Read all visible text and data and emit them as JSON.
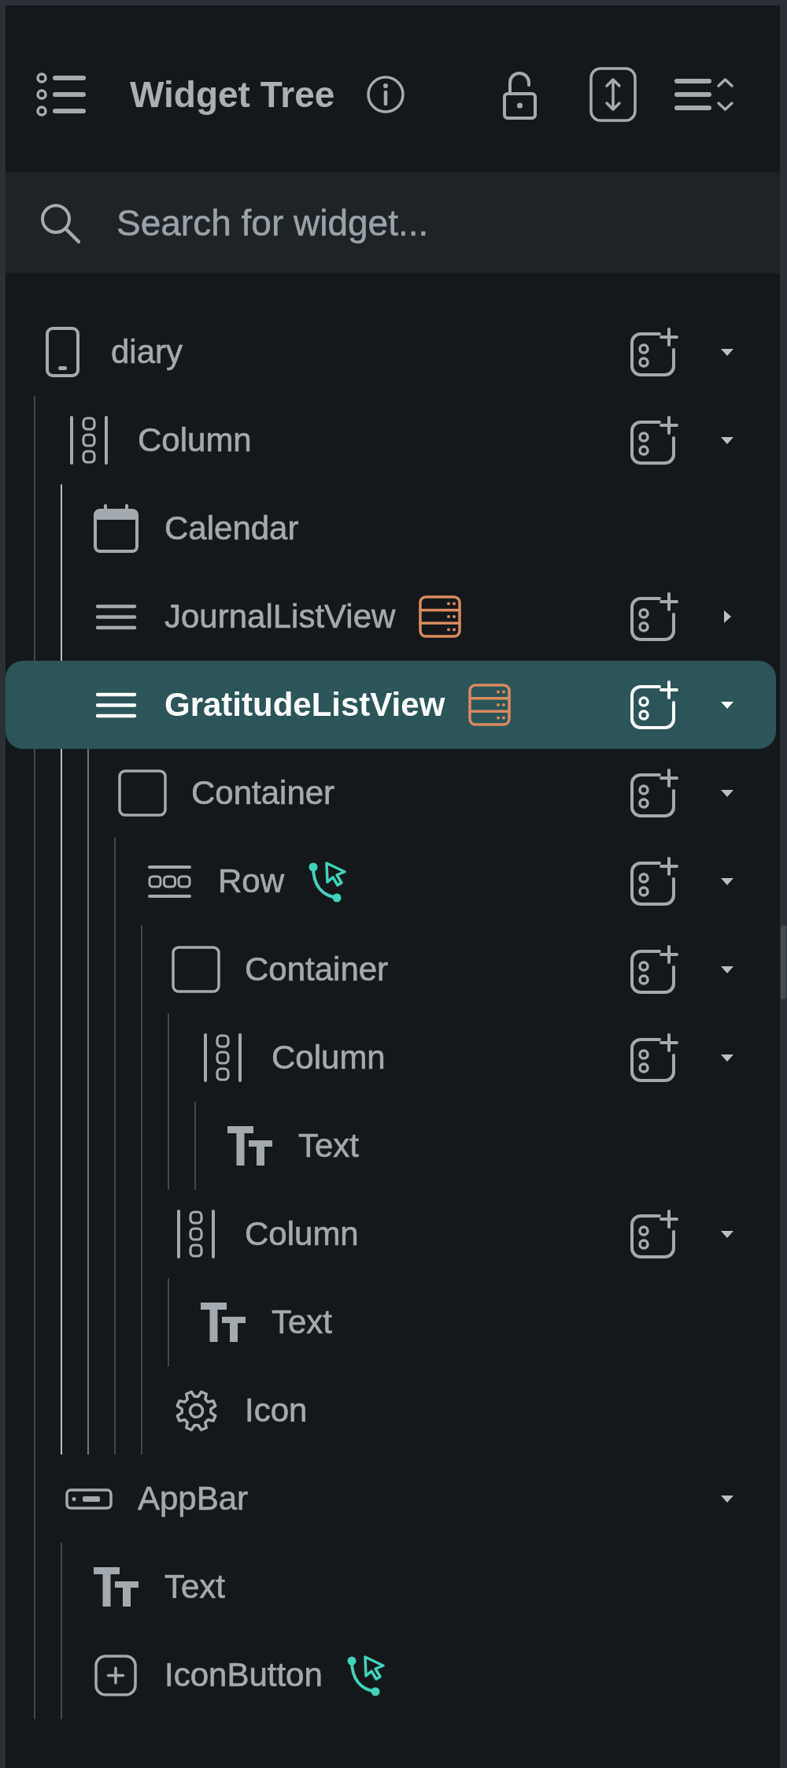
{
  "header": {
    "title": "Widget Tree"
  },
  "search": {
    "placeholder": "Search for widget..."
  },
  "tree": [
    {
      "label": "diary",
      "kind": "page",
      "selected": false,
      "add_button": true,
      "expanded": true,
      "children": [
        {
          "label": "Column",
          "kind": "column",
          "selected": false,
          "add_button": true,
          "expanded": true,
          "children": [
            {
              "label": "Calendar",
              "kind": "calendar",
              "selected": false,
              "add_button": false
            },
            {
              "label": "JournalListView",
              "kind": "listview",
              "badge": {
                "kind": "query"
              },
              "selected": false,
              "add_button": true,
              "expanded": false
            },
            {
              "label": "GratitudeListView",
              "kind": "listview",
              "badge": {
                "kind": "query"
              },
              "selected": true,
              "add_button": true,
              "expanded": true,
              "children": [
                {
                  "label": "Container",
                  "kind": "container",
                  "selected": false,
                  "add_button": true,
                  "expanded": true,
                  "children": [
                    {
                      "label": "Row",
                      "kind": "row",
                      "badge": {
                        "kind": "action"
                      },
                      "selected": false,
                      "add_button": true,
                      "expanded": true,
                      "children": [
                        {
                          "label": "Container",
                          "kind": "container",
                          "selected": false,
                          "add_button": true,
                          "expanded": true,
                          "children": [
                            {
                              "label": "Column",
                              "kind": "column",
                              "selected": false,
                              "add_button": true,
                              "expanded": true,
                              "children": [
                                {
                                  "label": "Text",
                                  "kind": "text",
                                  "selected": false,
                                  "add_button": false
                                }
                              ]
                            }
                          ]
                        },
                        {
                          "label": "Column",
                          "kind": "column",
                          "selected": false,
                          "add_button": true,
                          "expanded": true,
                          "children": [
                            {
                              "label": "Text",
                              "kind": "text",
                              "selected": false,
                              "add_button": false
                            }
                          ]
                        },
                        {
                          "label": "Icon",
                          "kind": "icon",
                          "selected": false,
                          "add_button": false
                        }
                      ]
                    }
                  ]
                }
              ]
            }
          ]
        },
        {
          "label": "AppBar",
          "kind": "appbar",
          "selected": false,
          "add_button": false,
          "expanded": true,
          "children": [
            {
              "label": "Text",
              "kind": "text",
              "selected": false,
              "add_button": false
            },
            {
              "label": "IconButton",
              "kind": "iconbutton",
              "badge": {
                "kind": "action"
              },
              "selected": false,
              "add_button": false
            }
          ]
        }
      ]
    }
  ]
}
